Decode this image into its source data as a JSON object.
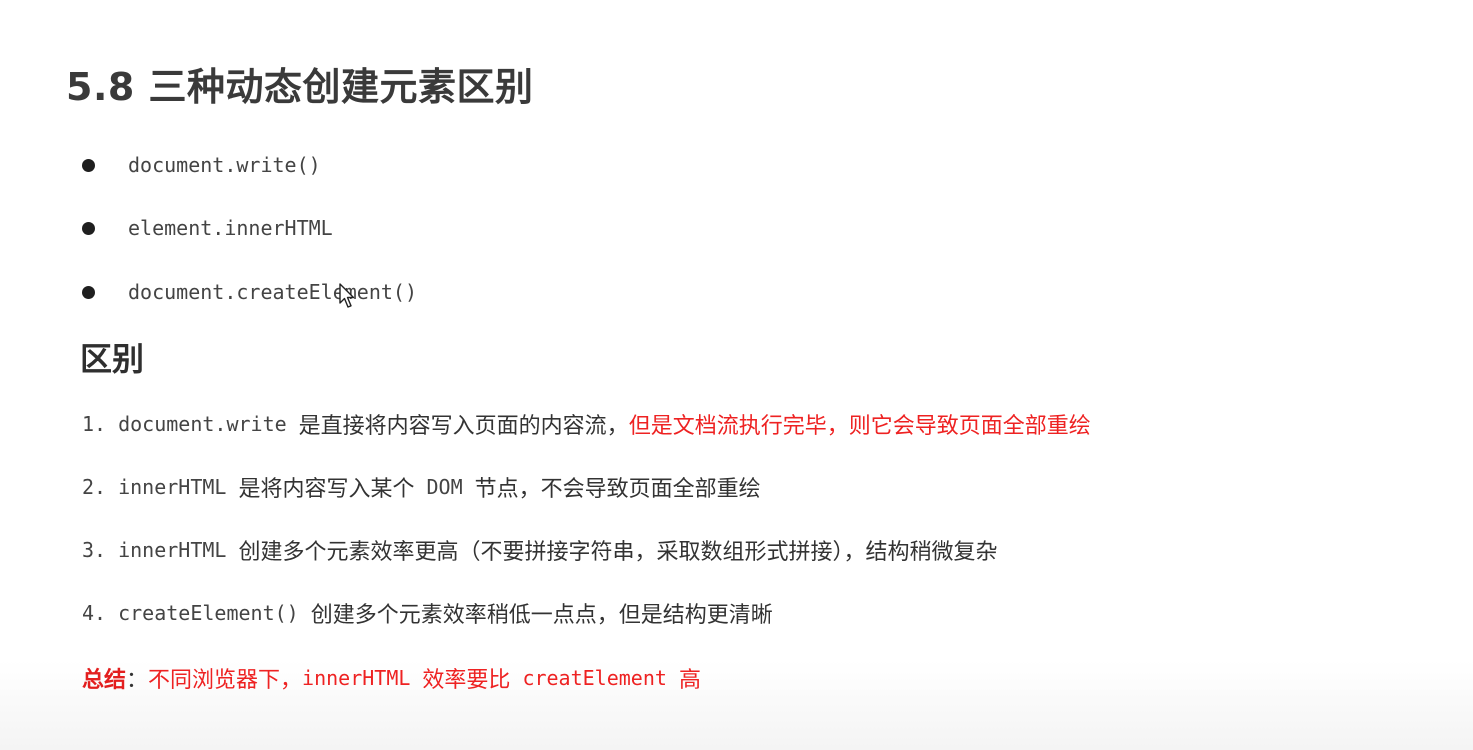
{
  "title": "5.8 三种动态创建元素区别",
  "methods": [
    "document.write()",
    "element.innerHTML",
    "document.createElement()"
  ],
  "difference_heading": "区别",
  "points": {
    "p1": {
      "num": "1.",
      "code": "document.write",
      "text": "是直接将内容写入页面的内容流，",
      "red_text": "但是文档流执行完毕，则它会导致页面全部重绘"
    },
    "p2": {
      "num": "2.",
      "code": "innerHTML",
      "text1": "是将内容写入某个",
      "code2": "DOM",
      "text2": "节点，不会导致页面全部重绘"
    },
    "p3": {
      "num": "3.",
      "code": "innerHTML",
      "text": "创建多个元素效率更高（不要拼接字符串，采取数组形式拼接），结构稍微复杂"
    },
    "p4": {
      "num": "4.",
      "code": "createElement()",
      "text": "创建多个元素效率稍低一点点，但是结构更清晰"
    }
  },
  "summary": {
    "label": "总结",
    "colon": "：",
    "text1": "不同浏览器下，",
    "code1": "innerHTML",
    "text2": "效率要比",
    "code2": "creatElement",
    "text3": "高"
  },
  "colors": {
    "red": "#ee2222",
    "text": "#333333",
    "title": "#3a3a3a"
  },
  "icons": {
    "cursor": "mouse-pointer-icon",
    "bullet": "bullet-dot-icon"
  }
}
